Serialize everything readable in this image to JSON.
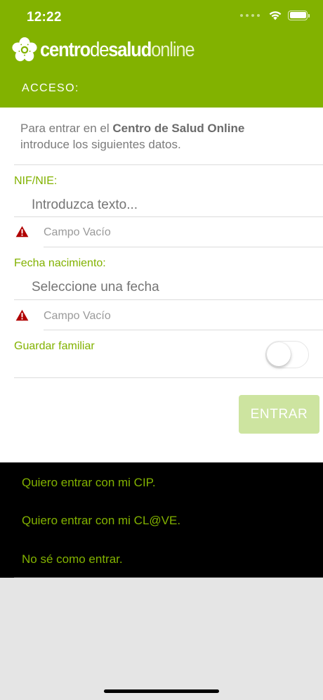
{
  "status_bar": {
    "time": "12:22",
    "wifi_icon": "wifi-icon",
    "battery_icon": "battery-icon"
  },
  "header": {
    "logo_icon": "hibiscus-flower-icon",
    "brand_part1": "centro",
    "brand_part2": "de",
    "brand_part3": "salud",
    "brand_part4": "online",
    "section_title": "ACCESO:"
  },
  "form": {
    "intro_prefix": "Para entrar en el ",
    "intro_bold": "Centro de Salud Online",
    "intro_suffix": "introduce los siguientes datos.",
    "nif": {
      "label": "NIF/NIE:",
      "placeholder": "Introduzca texto...",
      "value": "",
      "error": "Campo Vacío",
      "error_icon": "warning-icon"
    },
    "birthdate": {
      "label": "Fecha nacimiento:",
      "placeholder": "Seleccione una fecha",
      "value": "",
      "error": "Campo Vacío",
      "error_icon": "warning-icon"
    },
    "save_family": {
      "label": "Guardar familiar",
      "enabled": false
    },
    "submit_label": "ENTRAR"
  },
  "alt_access": {
    "links": [
      "Quiero entrar con mi CIP.",
      "Quiero entrar con mi CL@VE.",
      "No sé como entrar."
    ]
  },
  "colors": {
    "brand_green": "#82b200",
    "button_disabled": "#cde4a0",
    "error_red": "#b00000",
    "options_background": "#000000",
    "page_background": "#e5e5e5"
  }
}
